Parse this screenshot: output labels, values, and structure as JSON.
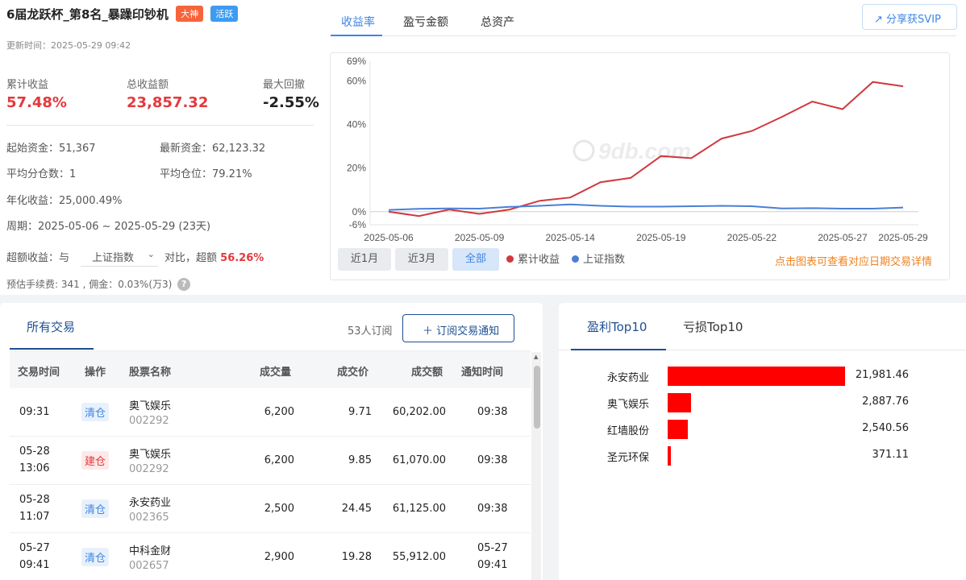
{
  "header": {
    "title": "6届龙跃杯_第8名_暴躁印钞机",
    "tags": [
      "大神",
      "活跃"
    ],
    "update_time": "更新时间：2025-05-29 09:42"
  },
  "metrics": [
    {
      "label": "累计收益",
      "value": "57.48%"
    },
    {
      "label": "总收益额",
      "value": "23,857.32"
    },
    {
      "label": "最大回撤",
      "value": "-2.55%"
    }
  ],
  "info": {
    "start_capital": "起始资金：51,367",
    "latest_capital": "最新资金：62,123.32",
    "avg_positions": "平均分仓数：1",
    "avg_position_rate": "平均仓位：79.21%",
    "annual_return": "年化收益：25,000.49%",
    "period": "周期：2025-05-06 ~ 2025-05-29 (23天)",
    "excess_prefix": "超额收益：与",
    "benchmark_selected": "上证指数",
    "excess_mid": "对比，超额",
    "excess_value": "56.26%",
    "fee": "预估手续费: 341 , 佣金：0.03%(万3)"
  },
  "chart_tabs": [
    "收益率",
    "盈亏金额",
    "总资产"
  ],
  "share_label": "分享获SVIP",
  "range_buttons": [
    "近1月",
    "近3月",
    "全部"
  ],
  "legend": [
    "累计收益",
    "上证指数"
  ],
  "chart_hint": "点击图表可查看对应日期交易详情",
  "watermark": "9db.com",
  "colors": {
    "cumulative": "#d0393e",
    "index": "#4a7fd6",
    "accent": "#3e86e5",
    "tab_active": "#1e4f92"
  },
  "chart_data": {
    "type": "line",
    "x": [
      "2025-05-06",
      "2025-05-07",
      "2025-05-08",
      "2025-05-09",
      "2025-05-12",
      "2025-05-13",
      "2025-05-14",
      "2025-05-15",
      "2025-05-16",
      "2025-05-19",
      "2025-05-20",
      "2025-05-21",
      "2025-05-22",
      "2025-05-23",
      "2025-05-26",
      "2025-05-27",
      "2025-05-28",
      "2025-05-29"
    ],
    "x_tick_labels": [
      "2025-05-06",
      "2025-05-09",
      "2025-05-14",
      "2025-05-19",
      "2025-05-22",
      "2025-05-27",
      "2025-05-29"
    ],
    "y_tick_labels": [
      "69%",
      "60%",
      "40%",
      "20%",
      "0%",
      "-6%"
    ],
    "ylim": [
      -6,
      69
    ],
    "series": [
      {
        "name": "累计收益",
        "values": [
          0,
          -2,
          1,
          -1,
          1,
          5,
          6.5,
          13.5,
          15.5,
          25.5,
          24.5,
          33.5,
          37,
          43.5,
          50.5,
          47,
          59.5,
          57.5
        ]
      },
      {
        "name": "上证指数",
        "values": [
          0.8,
          1.3,
          1.5,
          1.4,
          2.2,
          2.7,
          3.3,
          2.7,
          2.3,
          2.3,
          2.5,
          2.7,
          2.5,
          1.5,
          1.6,
          1.4,
          1.4,
          1.9
        ]
      }
    ]
  },
  "trades": {
    "tab": "所有交易",
    "subscribers": "53人订阅",
    "subscribe_button": "＋ 订阅交易通知",
    "columns": [
      "交易时间",
      "操作",
      "股票名称",
      "成交量",
      "成交价",
      "成交额",
      "通知时间"
    ],
    "rows": [
      {
        "time1": "09:31",
        "time2": "",
        "action": "清仓",
        "type": "clear",
        "name": "奥飞娱乐",
        "code": "002292",
        "volume": "6,200",
        "price": "9.71",
        "amount": "60,202.00",
        "notify1": "09:38",
        "notify2": ""
      },
      {
        "time1": "05-28",
        "time2": "13:06",
        "action": "建仓",
        "type": "build",
        "name": "奥飞娱乐",
        "code": "002292",
        "volume": "6,200",
        "price": "9.85",
        "amount": "61,070.00",
        "notify1": "09:38",
        "notify2": ""
      },
      {
        "time1": "05-28",
        "time2": "11:07",
        "action": "清仓",
        "type": "clear",
        "name": "永安药业",
        "code": "002365",
        "volume": "2,500",
        "price": "24.45",
        "amount": "61,125.00",
        "notify1": "09:38",
        "notify2": ""
      },
      {
        "time1": "05-27",
        "time2": "09:41",
        "action": "清仓",
        "type": "clear",
        "name": "中科金财",
        "code": "002657",
        "volume": "2,900",
        "price": "19.28",
        "amount": "55,912.00",
        "notify1": "05-27",
        "notify2": "09:41"
      }
    ]
  },
  "top10": {
    "tabs": [
      "盈利Top10",
      "亏损Top10"
    ],
    "items": [
      {
        "name": "永安药业",
        "value": "21,981.46",
        "amount": 21981.46
      },
      {
        "name": "奥飞娱乐",
        "value": "2,887.76",
        "amount": 2887.76
      },
      {
        "name": "红墙股份",
        "value": "2,540.56",
        "amount": 2540.56
      },
      {
        "name": "圣元环保",
        "value": "371.11",
        "amount": 371.11
      }
    ]
  }
}
